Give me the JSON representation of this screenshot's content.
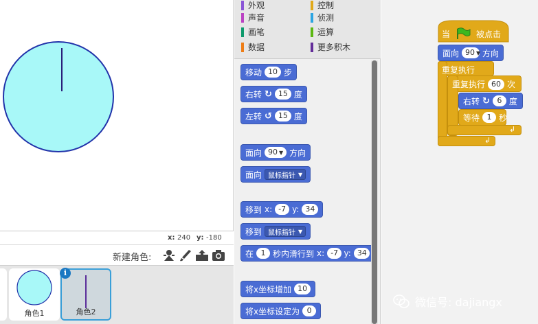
{
  "stage": {
    "coords": {
      "x_label": "x:",
      "x_value": "240",
      "y_label": "y:",
      "y_value": "-180"
    },
    "clock_colors": {
      "face": "#a8f8f8",
      "rim": "#2233aa",
      "hand": "#2a1f7a"
    }
  },
  "sprites": {
    "new_sprite_label": "新建角色:",
    "tools": [
      "sprite-library-icon",
      "paint-brush-icon",
      "upload-icon",
      "camera-icon"
    ],
    "items": [
      {
        "name": "角色1"
      },
      {
        "name": "角色2"
      }
    ],
    "info_badge": "i"
  },
  "categories": [
    {
      "label": "外观",
      "color": "#8a55d7"
    },
    {
      "label": "控制",
      "color": "#e1a91a"
    },
    {
      "label": "声音",
      "color": "#bb42c3"
    },
    {
      "label": "侦测",
      "color": "#2ca5e2"
    },
    {
      "label": "画笔",
      "color": "#0e9a6c"
    },
    {
      "label": "运算",
      "color": "#5cb712"
    },
    {
      "label": "数据",
      "color": "#ee7d16"
    },
    {
      "label": "更多积木",
      "color": "#632d99"
    }
  ],
  "palette": {
    "move": {
      "label": "移动",
      "value": "10",
      "suffix": "步"
    },
    "turn_right": {
      "label": "右转",
      "value": "15",
      "suffix": "度"
    },
    "turn_left": {
      "label": "左转",
      "value": "15",
      "suffix": "度"
    },
    "point_dir": {
      "label": "面向",
      "value": "90",
      "suffix": "方向"
    },
    "point_towards": {
      "label": "面向",
      "value": "鼠标指针"
    },
    "goto_xy": {
      "label": "移到",
      "x_label": "x:",
      "x_value": "-7",
      "y_label": "y:",
      "y_value": "34"
    },
    "goto": {
      "label": "移到",
      "value": "鼠标指针"
    },
    "glide": {
      "label": "在",
      "secs": "1",
      "mid": "秒内滑行到",
      "x_label": "x:",
      "x_value": "-7",
      "y_label": "y:",
      "y_value": "34"
    },
    "change_x": {
      "label": "将x坐标增加",
      "value": "10"
    },
    "set_x": {
      "label": "将x坐标设定为",
      "value": "0"
    }
  },
  "script": {
    "hat": {
      "label_pre": "当",
      "label_post": "被点击"
    },
    "point_dir": {
      "label": "面向",
      "value": "90",
      "suffix": "方向"
    },
    "forever": {
      "label": "重复执行"
    },
    "repeat": {
      "label": "重复执行",
      "value": "60",
      "suffix": "次"
    },
    "turn": {
      "label": "右转",
      "value": "6",
      "suffix": "度"
    },
    "wait": {
      "label": "等待",
      "value": "1",
      "suffix": "秒"
    }
  },
  "watermark": {
    "text": "微信号: dajiangx"
  }
}
